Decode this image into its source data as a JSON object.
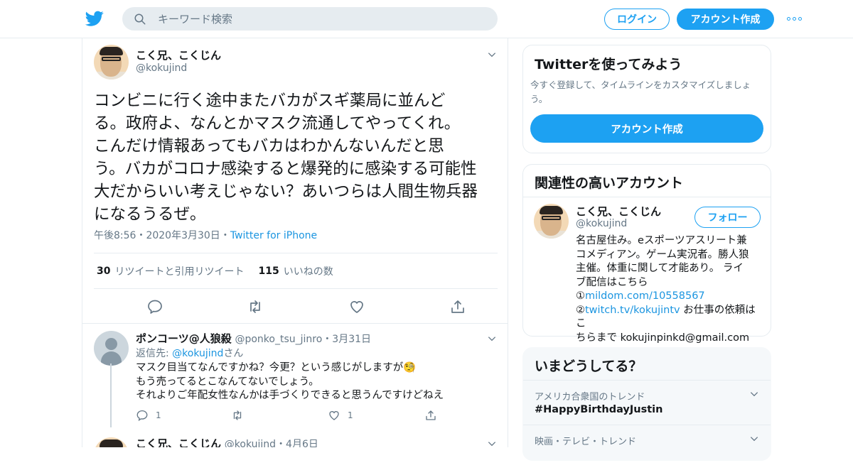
{
  "colors": {
    "accent": "#1da1f2",
    "link": "#1b95e0",
    "muted": "#657786",
    "border": "#e6ecf0"
  },
  "topbar": {
    "logo_icon": "twitter-bird-icon",
    "search_placeholder": "キーワード検索",
    "login_label": "ログイン",
    "signup_label": "アカウント作成",
    "more_icon": "more-dots-icon"
  },
  "tweet": {
    "name": "こく兄、こくじん",
    "handle": "@kokujind",
    "lines": [
      "コンビニに行く途中またバカがスギ薬局に並んど",
      "る。政府よ、なんとかマスク流通してやってくれ。",
      "こんだけ情報あってもバカはわかんないんだと思",
      "う。バカがコロナ感染すると爆発的に感染する可能性",
      "大だからいい考えじゃない？あいつらは人間生物兵器",
      "になるうるぜ。"
    ],
    "time": "午後8:56",
    "dot": "・",
    "date": "2020年3月30日",
    "source": "Twitter for iPhone",
    "retweets_count": "30",
    "retweets_label": "リツイートと引用リツイート",
    "likes_count": "115",
    "likes_label": "いいねの数"
  },
  "replies": [
    {
      "name": "ポンコーツ@人狼殺",
      "handle": "@ponko_tsu_jinro",
      "date": "・3月31日",
      "reply_prefix": "返信先: ",
      "reply_to": "@kokujind",
      "reply_suffix": "さん",
      "lines": [
        "マスク目当てなんですかね？今更？という感じがしますが🧐",
        "もう売ってるとこなんてないでしょう。",
        "それよりご年配女性なんかは手づくりできると思うんですけどねえ"
      ],
      "reply_count": "1",
      "retweet_count": "",
      "like_count": "1"
    },
    {
      "name": "こく兄、こくじん",
      "handle": "@kokujind",
      "date": "・4月6日"
    }
  ],
  "sidebar": {
    "try": {
      "title": "Twitterを使ってみよう",
      "subtitle_1": "今すぐ登録して、タイムラインをカスタマイズしましょ",
      "subtitle_2": "う。",
      "cta": "アカウント作成"
    },
    "related": {
      "title": "関連性の高いアカウント",
      "name": "こく兄、こくじん",
      "handle": "@kokujind",
      "follow_label": "フォロー",
      "bio_lines": [
        "名古屋住み。eスポーツアスリート兼",
        "コメディアン。ゲーム実況者。勝人狼",
        "主催。体重に関して才能あり。 ライ",
        "ブ配信はこちら"
      ],
      "bio_link1_prefix": "①",
      "bio_link1": "mildom.com/10558567",
      "bio_link2_prefix": "②",
      "bio_link2": "twitch.tv/kokujintv",
      "bio_link2_suffix": " お仕事の依頼はこ",
      "bio_last": "ちらまで kokujinpinkd@gmail.com"
    },
    "trends": {
      "title": "いまどうしてる？",
      "items": [
        {
          "category": "アメリカ合衆国のトレンド",
          "title": "#HappyBirthdayJustin"
        },
        {
          "category": "映画・テレビ・トレンド",
          "title": ""
        }
      ]
    }
  }
}
